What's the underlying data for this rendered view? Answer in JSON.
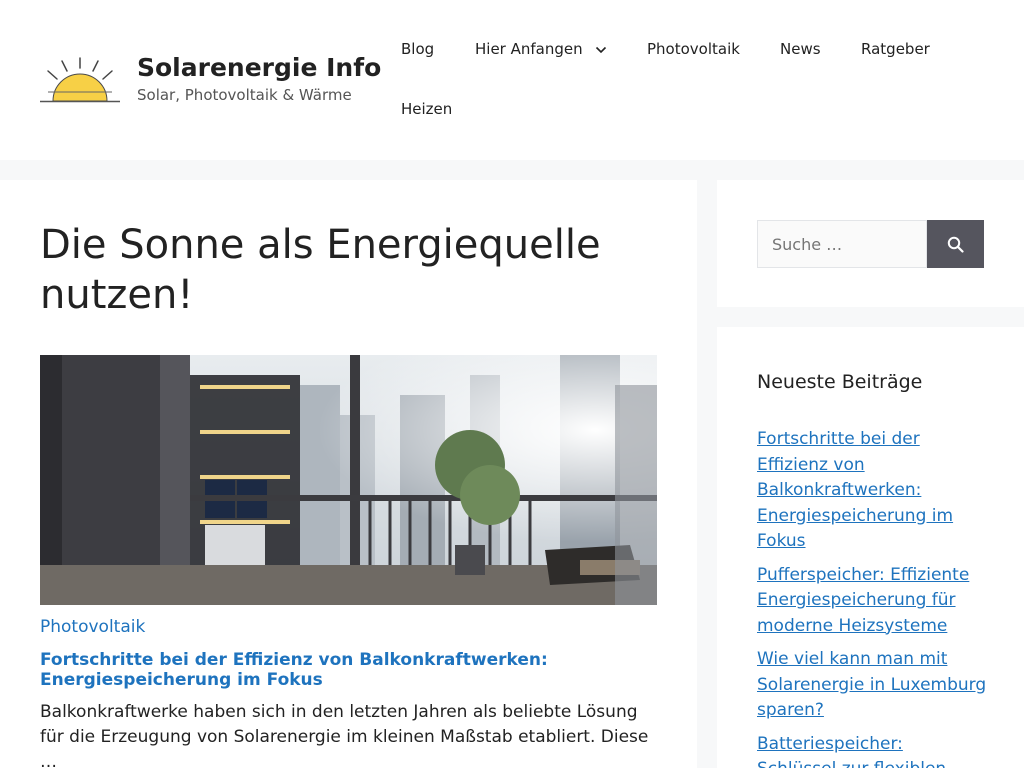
{
  "site": {
    "title": "Solarenergie Info",
    "tagline": "Solar, Photovoltaik & Wärme"
  },
  "nav": {
    "items": [
      {
        "label": "Blog"
      },
      {
        "label": "Hier Anfangen",
        "has_dropdown": true
      },
      {
        "label": "Photovoltaik"
      },
      {
        "label": "News"
      },
      {
        "label": "Ratgeber"
      },
      {
        "label": "Heizen"
      }
    ]
  },
  "main": {
    "page_title": "Die Sonne als Energiequelle nutzen!",
    "post": {
      "category": "Photovoltaik",
      "title": "Fortschritte bei der Effizienz von Balkonkraftwerken: Energiespeicherung im Fokus",
      "excerpt": "Balkonkraftwerke haben sich in den letzten Jahren als beliebte Lösung für die Erzeugung von Solarenergie im kleinen Maßstab etabliert. Diese …"
    }
  },
  "sidebar": {
    "search": {
      "placeholder": "Suche …",
      "button_icon": "search-icon"
    },
    "recent": {
      "title": "Neueste Beiträge",
      "items": [
        {
          "label": "Fortschritte bei der Effizienz von Balkonkraftwerken: Energiespeicherung im Fokus"
        },
        {
          "label": "Pufferspeicher: Effiziente Energiespeicherung für moderne Heizsysteme"
        },
        {
          "label": "Wie viel kann man mit Solarenergie in Luxemburg sparen?"
        },
        {
          "label": "Batteriespeicher: Schlüssel zur flexiblen"
        }
      ]
    }
  },
  "colors": {
    "link": "#1e73be",
    "search_button": "#55555e",
    "sun": "#f7d046",
    "background": "#f7f8f9"
  }
}
